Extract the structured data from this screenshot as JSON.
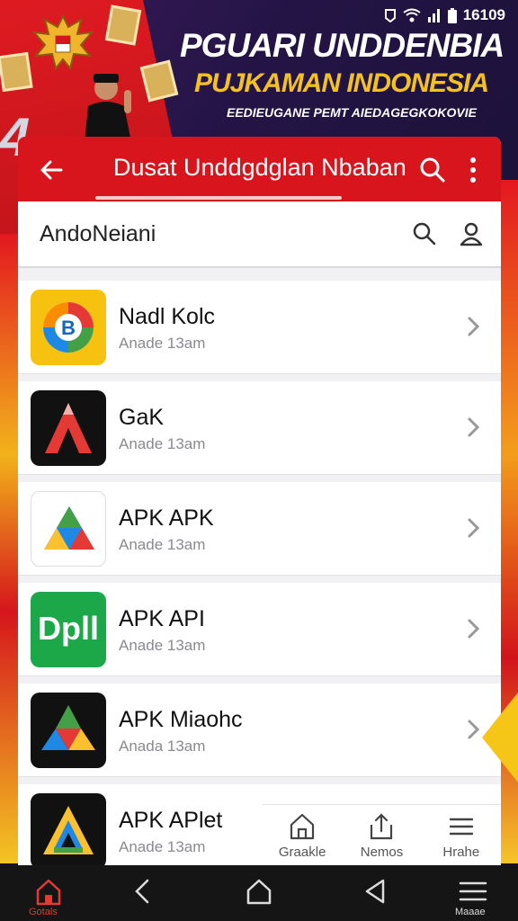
{
  "status_bar": {
    "time": "16109"
  },
  "banner": {
    "title_line1": "PGUARI UNDDENBIA",
    "title_line2": "PUJKAMAN INDONESIA",
    "subtitle": "EEDIEUGANE PEMT AIEDAGEGKOKOVIE",
    "big_text": "4"
  },
  "app_bar": {
    "title": "Dusat Unddgdglan Nbaban"
  },
  "search": {
    "value": "AndoNeiani"
  },
  "apps": [
    {
      "name": "Nadl Kolc",
      "subtitle": "Anade 13am"
    },
    {
      "name": "GaK",
      "subtitle": "Anade 13am"
    },
    {
      "name": "APK APK",
      "subtitle": "Anade 13am"
    },
    {
      "name": "APK API",
      "subtitle": "Anade 13am",
      "icon_text": "Dpll"
    },
    {
      "name": "APK Miaohc",
      "subtitle": "Anada 13am"
    },
    {
      "name": "APK APlet",
      "subtitle": "Anade 13am"
    }
  ],
  "mini_nav": [
    {
      "label": "Graakle",
      "icon": "home-outline-icon"
    },
    {
      "label": "Nemos",
      "icon": "share-icon"
    },
    {
      "label": "Hrahe",
      "icon": "menu-icon"
    }
  ],
  "system_nav": {
    "home_label": "Gotals",
    "menu_label": "Maaae"
  },
  "colors": {
    "brand_red": "#d8141c",
    "accent_yellow": "#f4c21f"
  }
}
